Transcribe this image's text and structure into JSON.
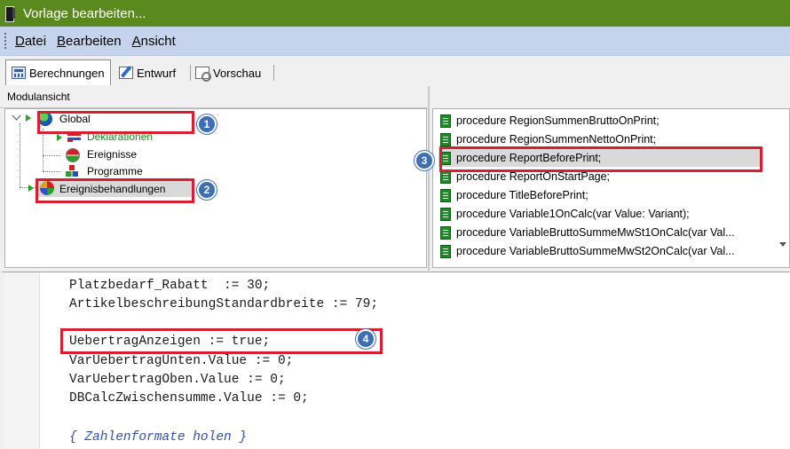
{
  "window": {
    "title": "Vorlage bearbeiten..."
  },
  "menu": {
    "items": [
      "Datei",
      "Bearbeiten",
      "Ansicht"
    ]
  },
  "tabs": [
    {
      "label": "Berechnungen",
      "icon": "calculator-icon",
      "active": true
    },
    {
      "label": "Entwurf",
      "icon": "edit-icon",
      "active": false
    },
    {
      "label": "Vorschau",
      "icon": "preview-icon",
      "active": false
    }
  ],
  "module_view": {
    "header": "Modulansicht",
    "tree": {
      "global": "Global",
      "declarations": "Deklarationen",
      "events": "Ereignisse",
      "programs": "Programme",
      "event_handlers": "Ereignisbehandlungen"
    }
  },
  "procedures": [
    "procedure RegionSummenBruttoOnPrint;",
    "procedure RegionSummenNettoOnPrint;",
    "procedure ReportBeforePrint;",
    "procedure ReportOnStartPage;",
    "procedure TitleBeforePrint;",
    "procedure Variable1OnCalc(var Value: Variant);",
    "procedure VariableBruttoSummeMwSt1OnCalc(var Val...",
    "procedure VariableBruttoSummeMwSt2OnCalc(var Val..."
  ],
  "code": {
    "lines": [
      "Platzbedarf_Rabatt  := 30;",
      "ArtikelbeschreibungStandardbreite := 79;",
      "",
      "UebertragAnzeigen := true;",
      "VarUebertragUnten.Value := 0;",
      "VarUebertragOben.Value := 0;",
      "DBCalcZwischensumme.Value := 0;",
      "",
      "{ Zahlenformate holen }"
    ]
  },
  "callouts": [
    "1",
    "2",
    "3",
    "4"
  ],
  "colors": {
    "titlebar": "#5a8a1e",
    "menubar": "#c6d3ec",
    "highlight": "#d42030",
    "badge": "#3f6fb3"
  }
}
